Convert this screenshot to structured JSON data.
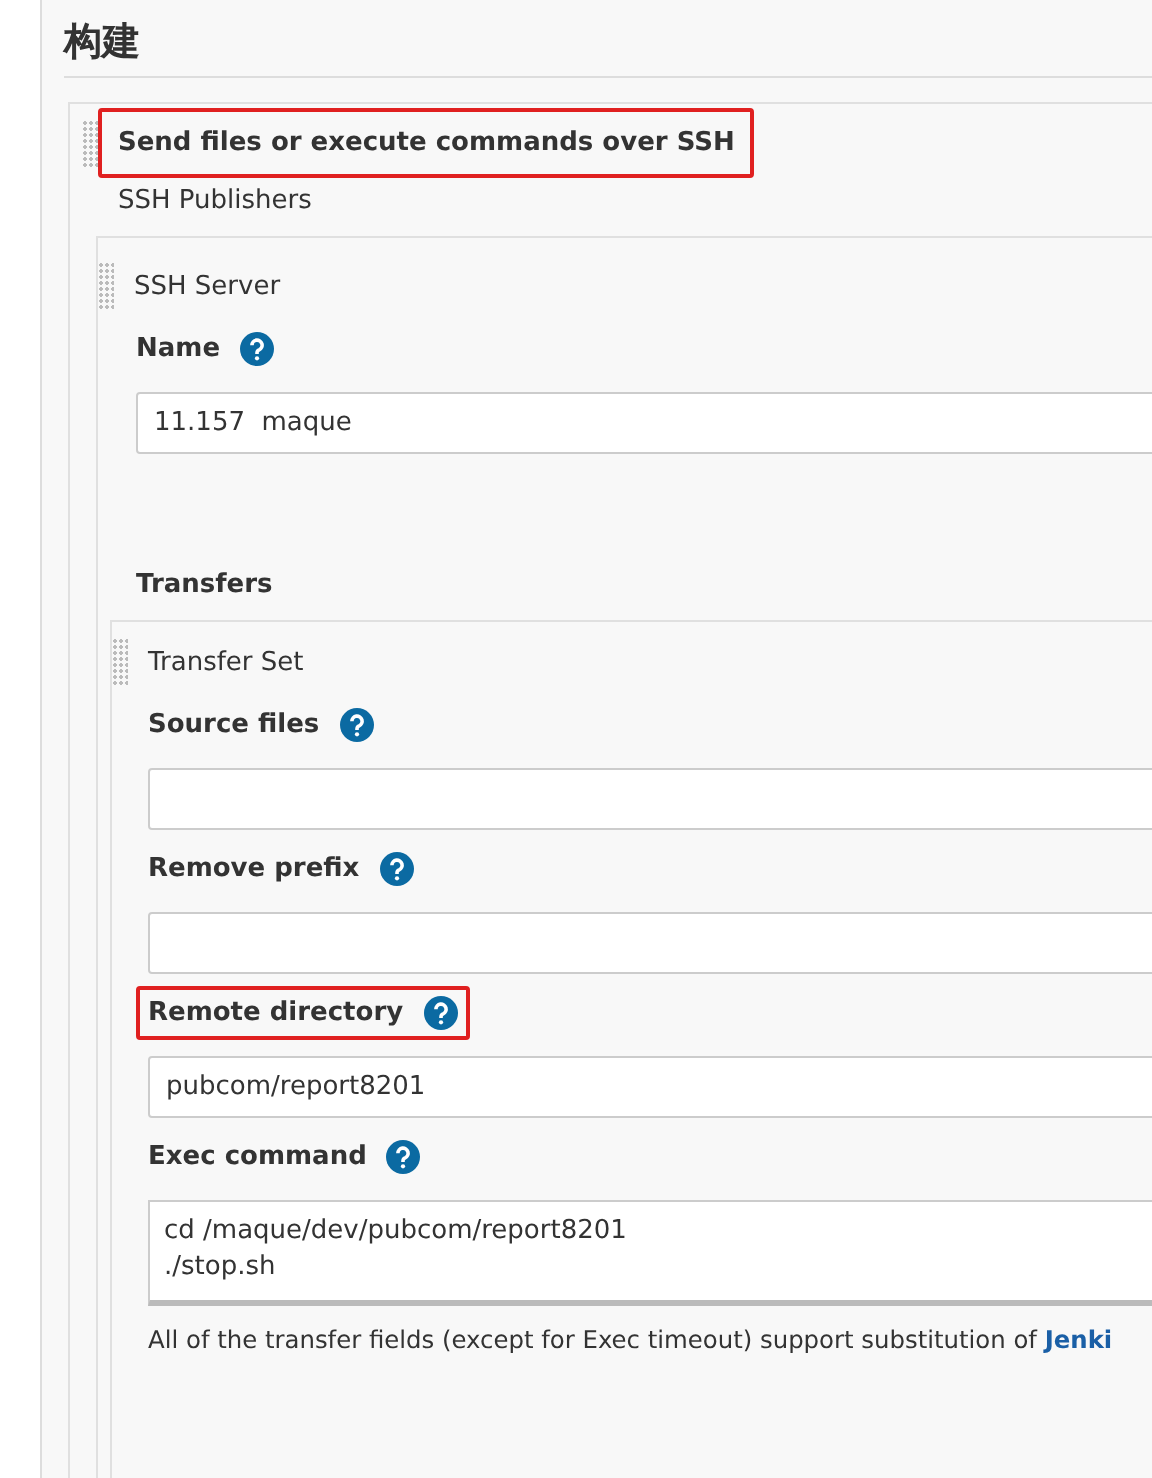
{
  "section": {
    "title": "构建"
  },
  "step": {
    "title": "Send files or execute commands over SSH",
    "highlighted": true,
    "group_label": "SSH Publishers",
    "server": {
      "title": "SSH Server",
      "name_field": {
        "label": "Name",
        "value": "11.157  maque"
      },
      "transfers_label": "Transfers",
      "transfer_set": {
        "title": "Transfer Set",
        "fields": [
          {
            "label": "Source files",
            "kind": "input",
            "highlighted": false
          },
          {
            "label": "Remove prefix",
            "kind": "input",
            "highlighted": false
          },
          {
            "label": "Remote directory",
            "kind": "input",
            "value": "pubcom/report8201",
            "highlighted": true
          },
          {
            "label": "Exec command",
            "kind": "textarea",
            "value": "cd /maque/dev/pubcom/report8201\n./stop.sh",
            "highlighted": false
          }
        ],
        "note": {
          "text": "All of the transfer fields (except for Exec timeout) support substitution of ",
          "link": "Jenki"
        }
      }
    }
  }
}
